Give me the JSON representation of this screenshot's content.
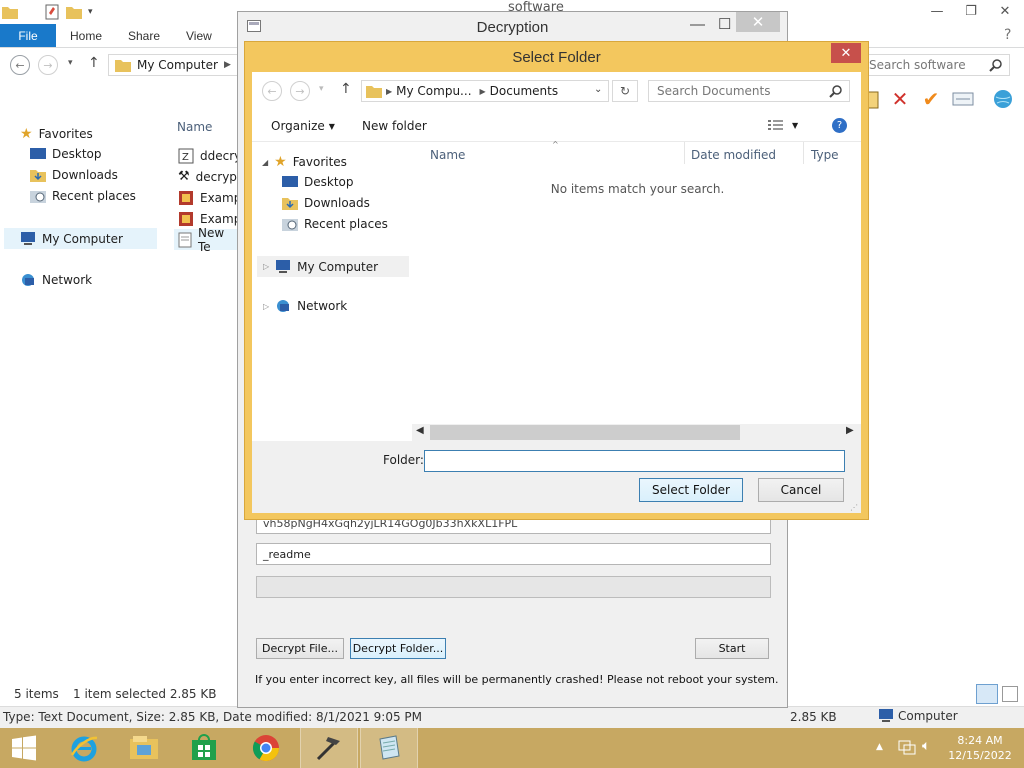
{
  "explorer": {
    "title": "software",
    "ribbon_tabs": [
      "File",
      "Home",
      "Share",
      "View"
    ],
    "address": "My Computer",
    "search_placeholder": "Search software",
    "nav": {
      "favorites": "Favorites",
      "desktop": "Desktop",
      "downloads": "Downloads",
      "recent": "Recent places",
      "my_computer": "My Computer",
      "network": "Network"
    },
    "column_name": "Name",
    "files": [
      "ddecryp",
      "decrypt",
      "Exampl",
      "Exampl",
      "New Te"
    ],
    "status_items": "5 items",
    "status_selected": "1 item selected  2.85 KB",
    "detail_text": "Type: Text Document, Size: 2.85 KB, Date modified: 8/1/2021 9:05 PM",
    "detail_size": "2.85 KB",
    "detail_location": "Computer"
  },
  "decryption": {
    "title": "Decryption",
    "key_field_partial": "vh58pNgH4xGqh2yjLR14GOg0Jb33hXkXL1FPL",
    "extension_field": "_readme",
    "btn_decrypt_file": "Decrypt File...",
    "btn_decrypt_folder": "Decrypt Folder...",
    "btn_start": "Start",
    "warning": "If you enter incorrect key, all files will be permanently crashed! Please not reboot your system."
  },
  "select_folder": {
    "title": "Select Folder",
    "breadcrumb": [
      "My Compu...",
      "Documents"
    ],
    "search_placeholder": "Search Documents",
    "organize": "Organize",
    "new_folder": "New folder",
    "nav": {
      "favorites": "Favorites",
      "desktop": "Desktop",
      "downloads": "Downloads",
      "recent": "Recent places",
      "my_computer": "My Computer",
      "network": "Network"
    },
    "columns": [
      "Name",
      "Date modified",
      "Type"
    ],
    "empty_message": "No items match your search.",
    "folder_label": "Folder:",
    "folder_value": "",
    "btn_select": "Select Folder",
    "btn_cancel": "Cancel"
  },
  "taskbar": {
    "time": "8:24 AM",
    "date": "12/15/2022"
  },
  "colors": {
    "file_tab": "#1979ca",
    "dialog_frame": "#f3c75e",
    "taskbar": "#c7a862",
    "close_button": "#c7504b"
  }
}
